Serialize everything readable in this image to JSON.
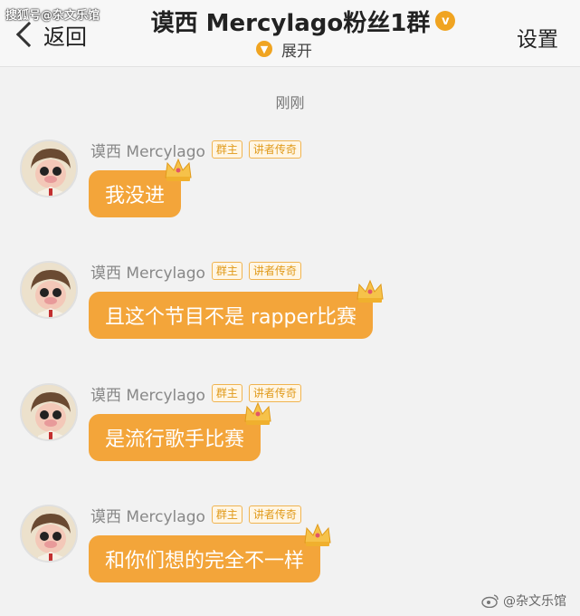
{
  "watermark_top": "搜狐号@杂文乐馆",
  "header": {
    "back_label": "返回",
    "title": "谟西 Mercylago粉丝1群",
    "expand_label": "展开",
    "settings_label": "设置"
  },
  "timestamp": "刚刚",
  "messages": [
    {
      "sender": "谟西 Mercylago",
      "tags": [
        "群主",
        "讲者传奇"
      ],
      "text": "我没进"
    },
    {
      "sender": "谟西 Mercylago",
      "tags": [
        "群主",
        "讲者传奇"
      ],
      "text": "且这个节目不是 rapper比赛"
    },
    {
      "sender": "谟西 Mercylago",
      "tags": [
        "群主",
        "讲者传奇"
      ],
      "text": "是流行歌手比赛"
    },
    {
      "sender": "谟西 Mercylago",
      "tags": [
        "群主",
        "讲者传奇"
      ],
      "text": "和你们想的完全不一样"
    }
  ],
  "watermark_bottom": "@杂文乐馆",
  "colors": {
    "bubble": "#f3a53a",
    "accent": "#f0a421",
    "background": "#f2f2f2"
  },
  "icons": [
    "chevron-left-icon",
    "verified-badge-icon",
    "chevron-down-icon",
    "crown-icon",
    "weibo-icon"
  ]
}
